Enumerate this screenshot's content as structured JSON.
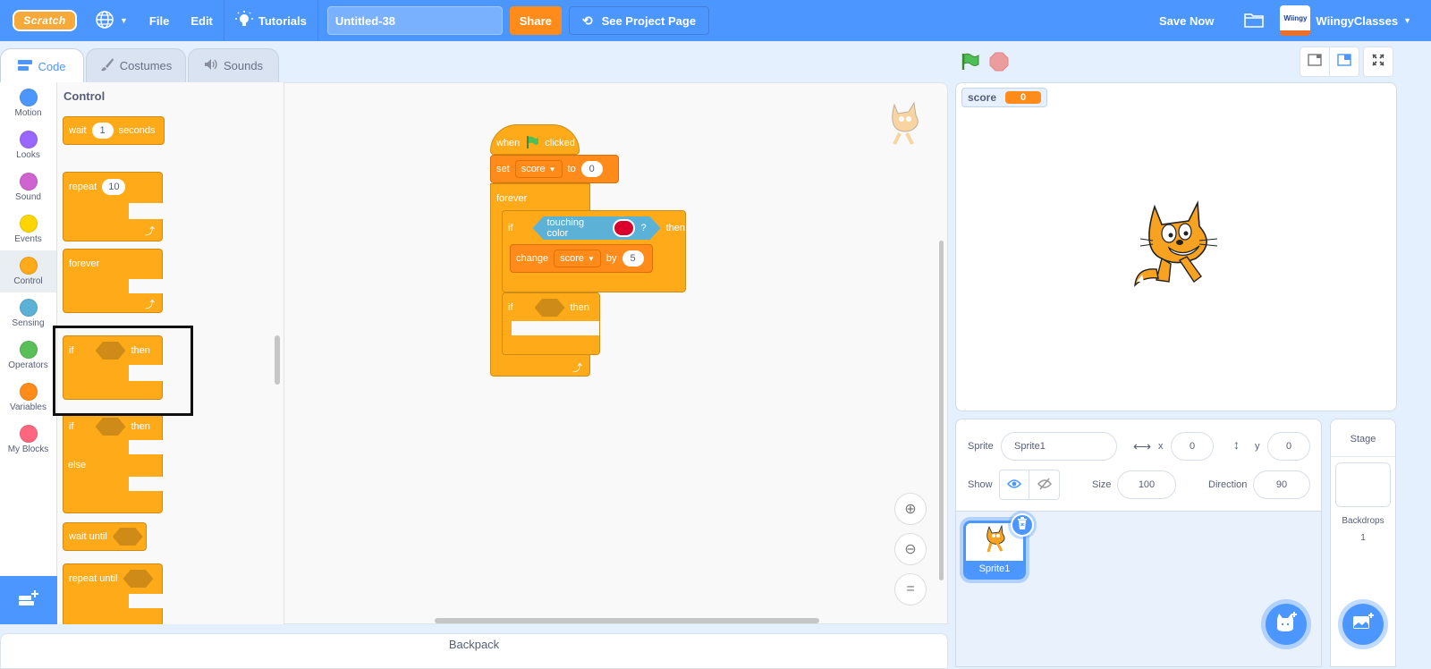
{
  "menubar": {
    "logo": "Scratch",
    "file": "File",
    "edit": "Edit",
    "tutorials": "Tutorials",
    "project_title": "Untitled-38",
    "share": "Share",
    "see_project_page": "See Project Page",
    "save_now": "Save Now",
    "username": "WiingyClasses",
    "avatar_text": "Wiingy"
  },
  "tabs": {
    "code": "Code",
    "costumes": "Costumes",
    "sounds": "Sounds"
  },
  "categories": [
    {
      "label": "Motion",
      "color": "#4c97ff"
    },
    {
      "label": "Looks",
      "color": "#9966ff"
    },
    {
      "label": "Sound",
      "color": "#cf63cf"
    },
    {
      "label": "Events",
      "color": "#ffd500"
    },
    {
      "label": "Control",
      "color": "#ffab19"
    },
    {
      "label": "Sensing",
      "color": "#5cb1d6"
    },
    {
      "label": "Operators",
      "color": "#59c059"
    },
    {
      "label": "Variables",
      "color": "#ff8c1a"
    },
    {
      "label": "My Blocks",
      "color": "#ff6680"
    }
  ],
  "palette": {
    "title": "Control",
    "wait": {
      "label": "wait",
      "value": "1",
      "suffix": "seconds"
    },
    "repeat": {
      "label": "repeat",
      "value": "10"
    },
    "forever": "forever",
    "if_then": {
      "if": "if",
      "then": "then"
    },
    "if_else": {
      "if": "if",
      "then": "then",
      "else": "else"
    },
    "wait_until": "wait until",
    "repeat_until": "repeat until"
  },
  "script": {
    "hat": {
      "when": "when",
      "clicked": "clicked"
    },
    "set": {
      "label": "set",
      "variable": "score",
      "to": "to",
      "value": "0"
    },
    "forever": "forever",
    "if1": {
      "if": "if",
      "sensing": "touching color",
      "question": "?",
      "then": "then",
      "color": "#d9002b"
    },
    "change": {
      "label": "change",
      "variable": "score",
      "by": "by",
      "value": "5"
    },
    "if2": {
      "if": "if",
      "then": "then"
    }
  },
  "backpack": "Backpack",
  "stage": {
    "monitor_label": "score",
    "monitor_value": "0"
  },
  "sprite_info": {
    "sprite_label": "Sprite",
    "sprite_name": "Sprite1",
    "x_label": "x",
    "x": "0",
    "y_label": "y",
    "y": "0",
    "show_label": "Show",
    "size_label": "Size",
    "size": "100",
    "direction_label": "Direction",
    "direction": "90"
  },
  "sprites": [
    {
      "name": "Sprite1"
    }
  ],
  "stage_panel": {
    "title": "Stage",
    "backdrops_label": "Backdrops",
    "backdrops_count": "1"
  }
}
